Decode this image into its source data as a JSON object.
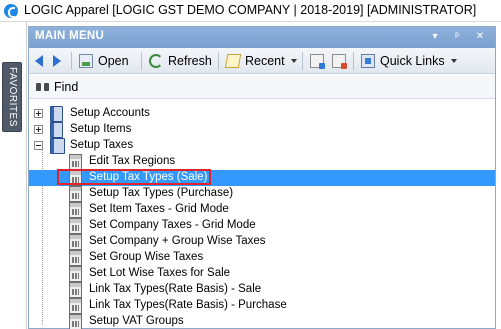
{
  "window": {
    "title": "LOGIC Apparel [LOGIC GST DEMO COMPANY | 2018-2019] [ADMINISTRATOR]"
  },
  "sidebar": {
    "favorites_label": "FAVORITES"
  },
  "panel": {
    "title": "MAIN MENU",
    "header_buttons": [
      "▾",
      "ᵖ",
      "✕"
    ]
  },
  "toolbar": {
    "open_label": "Open",
    "refresh_label": "Refresh",
    "recent_label": "Recent",
    "quick_links_label": "Quick Links"
  },
  "find": {
    "label": "Find"
  },
  "tree": {
    "items": [
      {
        "label": "Setup Accounts",
        "level": 0,
        "expander": "plus",
        "icon": "book-icon"
      },
      {
        "label": "Setup Items",
        "level": 0,
        "expander": "plus",
        "icon": "book-icon"
      },
      {
        "label": "Setup Taxes",
        "level": 0,
        "expander": "minus",
        "icon": "book-open-icon"
      },
      {
        "label": "Edit Tax Regions",
        "level": 1,
        "icon": "calculator-icon"
      },
      {
        "label": "Setup Tax Types (Sale)",
        "level": 1,
        "icon": "calculator-icon",
        "selected": true
      },
      {
        "label": "Setup Tax Types (Purchase)",
        "level": 1,
        "icon": "calculator-icon"
      },
      {
        "label": "Set Item Taxes - Grid Mode",
        "level": 1,
        "icon": "calculator-icon"
      },
      {
        "label": "Set Company Taxes - Grid Mode",
        "level": 1,
        "icon": "calculator-icon"
      },
      {
        "label": "Set Company + Group Wise Taxes",
        "level": 1,
        "icon": "calculator-icon"
      },
      {
        "label": "Set Group Wise Taxes",
        "level": 1,
        "icon": "calculator-icon"
      },
      {
        "label": "Set Lot Wise Taxes for Sale",
        "level": 1,
        "icon": "calculator-icon"
      },
      {
        "label": "Link Tax Types(Rate Basis) - Sale",
        "level": 1,
        "icon": "calculator-icon"
      },
      {
        "label": "Link Tax Types(Rate Basis) - Purchase",
        "level": 1,
        "icon": "calculator-icon"
      },
      {
        "label": "Setup VAT Groups",
        "level": 1,
        "icon": "calculator-icon"
      }
    ]
  },
  "colors": {
    "header_blue": "#8fb2dc",
    "selection_blue": "#3399ff",
    "highlight_red": "#e0242c"
  }
}
